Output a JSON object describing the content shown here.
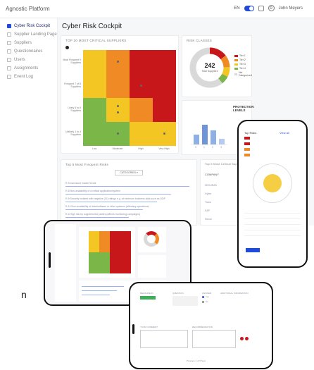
{
  "app": {
    "brand": "Agnostic Platform",
    "page_title": "Cyber Risk Cockpit",
    "user_name": "John Meyers",
    "avatar_initial": "R",
    "lang": "EN",
    "nav": [
      {
        "label": "Cyber Risk Cockpit",
        "active": true
      },
      {
        "label": "Supplier Landing Page",
        "active": false
      },
      {
        "label": "Suppliers",
        "active": false
      },
      {
        "label": "Questionnaires",
        "active": false
      },
      {
        "label": "Users",
        "active": false
      },
      {
        "label": "Assignments",
        "active": false
      },
      {
        "label": "Event Log",
        "active": false
      }
    ]
  },
  "heatmap": {
    "title": "TOP 20 MOST CRITICAL SUPPLIERS",
    "y_labels": [
      "Most Frequent 9 Suppliers",
      "Frequent 7 of 8 Suppliers",
      "Likely 5 to 6 Suppliers",
      "Unlikely 1 to 4 Suppliers"
    ],
    "x_labels": [
      "Low",
      "Moderate",
      "High",
      "Very High"
    ]
  },
  "risk_classes": {
    "title": "RISK CLASSES",
    "center_value": "242",
    "center_label": "Total Suppliers",
    "legend": [
      {
        "label": "Tier 1",
        "color": "#c8171b"
      },
      {
        "label": "Tier 2",
        "color": "#f08a24"
      },
      {
        "label": "Tier 3",
        "color": "#f3c623"
      },
      {
        "label": "Tier 4",
        "color": "#7ab648"
      },
      {
        "label": "Not Categorized",
        "color": "#d9d9d9"
      }
    ]
  },
  "protection": {
    "title": "PROTECTION LEVELS",
    "x_labels": [
      "0",
      "1",
      "2",
      "3"
    ]
  },
  "frequent_risks": {
    "title": "Top 5 Most Frequent Risks",
    "button": "CATEGORIES ▾",
    "items": [
      {
        "text": "R-5 Increased Insider threat"
      },
      {
        "text": "R-8 Non-availability of a critical application/system"
      },
      {
        "text": "R-9 Security incident with negative (CI) ratings e.g. at minimum business data such as GDP"
      },
      {
        "text": "R-10 Non-availability of data/software or other systems (affecting operations)"
      },
      {
        "text": "R-6 High risk by suppliers/3rd parties (affects monitoring campaigns)"
      }
    ]
  },
  "critical_suppliers": {
    "title": "Top 5 Most Critical Suppliers",
    "header": "COMPANY",
    "items": [
      "SECURAS",
      "Cyber",
      "Trans",
      "SAP",
      "Securi"
    ]
  },
  "phone": {
    "risk_label": "Top Risks",
    "link": "View all"
  },
  "form": {
    "col1": "MEASURE ID",
    "col2": "QUESTION",
    "col3": "ANSWER",
    "col4": "ADDITIONAL INFORMATION",
    "answer_yes": "Yes",
    "answer_no": "No",
    "section2": "YOUR COMMENT",
    "section3": "RECOMMENDATION",
    "footer": "Previous   1  of  5   Next"
  },
  "side_text": "n"
}
